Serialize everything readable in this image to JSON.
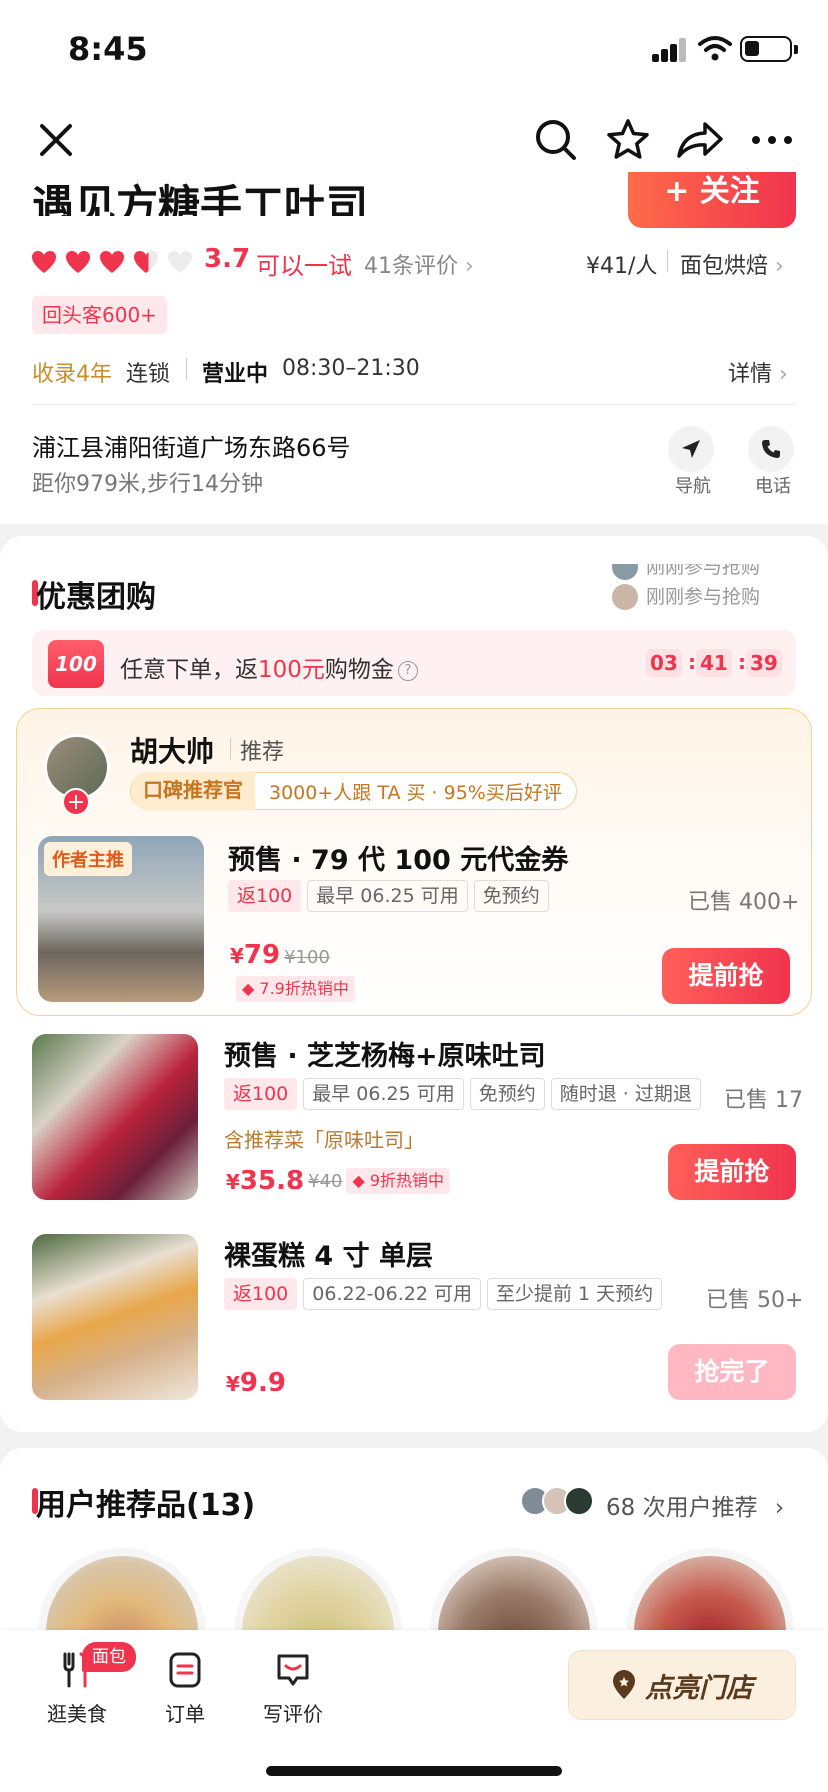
{
  "status_bar": {
    "time": "8:45"
  },
  "header": {
    "shop_name": "遇见方糖手工吐司",
    "follow_label": "+ 关注",
    "rating_score": "3.7",
    "rating_level": "可以一试",
    "review_count": "41条评价",
    "price_per_person": "¥41/人",
    "category": "面包烘焙",
    "repeat_badge": "回头客600+",
    "listed": "收录4年",
    "chain": "连锁",
    "open_status": "营业中",
    "hours": "08:30–21:30",
    "details": "详情",
    "address": "浦江县浦阳街道广场东路66号",
    "distance": "距你979米,步行14分钟",
    "nav_label": "导航",
    "phone_label": "电话"
  },
  "deals": {
    "title": "优惠团购",
    "ticker": [
      "刚刚参与抢购",
      "刚刚参与抢购"
    ],
    "promo_badge": "100",
    "promo_prefix": "任意下单，返",
    "promo_amount": "100元",
    "promo_suffix": "购物金",
    "countdown": [
      "03",
      "41",
      "39"
    ],
    "recommender": {
      "name": "胡大帅",
      "label": "推荐",
      "badge": "口碑推荐官",
      "stats": "3000+人跟 TA 买 · 95%买后好评"
    },
    "items": [
      {
        "tag": "作者主推",
        "title": "预售 · 79 代 100 元代金券",
        "chips": [
          "返100",
          "最早 06.25 可用",
          "免预约"
        ],
        "sold": "已售 400+",
        "price_symbol": "¥",
        "price": "79",
        "old_price": "¥100",
        "hot": "7.9折热销中",
        "button": "提前抢"
      },
      {
        "title": "预售 · 芝芝杨梅+原味吐司",
        "chips": [
          "返100",
          "最早 06.25 可用",
          "免预约",
          "随时退 · 过期退"
        ],
        "sold": "已售 17",
        "sub": "含推荐菜「原味吐司」",
        "price_symbol": "¥",
        "price": "35.8",
        "old_price": "¥40",
        "hot": "9折热销中",
        "button": "提前抢"
      },
      {
        "title": "裸蛋糕 4 寸 单层",
        "chips": [
          "返100",
          "06.22-06.22 可用",
          "至少提前 1 天预约"
        ],
        "sold": "已售 50+",
        "price_symbol": "¥",
        "price": "9.9",
        "button": "抢完了"
      }
    ]
  },
  "user_recs": {
    "title": "用户推荐品(13)",
    "count_text": "68 次用户推荐"
  },
  "bottom_bar": {
    "tabs": [
      "逛美食",
      "订单",
      "写评价"
    ],
    "badge": "面包",
    "light_store": "点亮门店"
  },
  "colors": {
    "accent": "#f0344d",
    "gold": "#c8751f"
  }
}
